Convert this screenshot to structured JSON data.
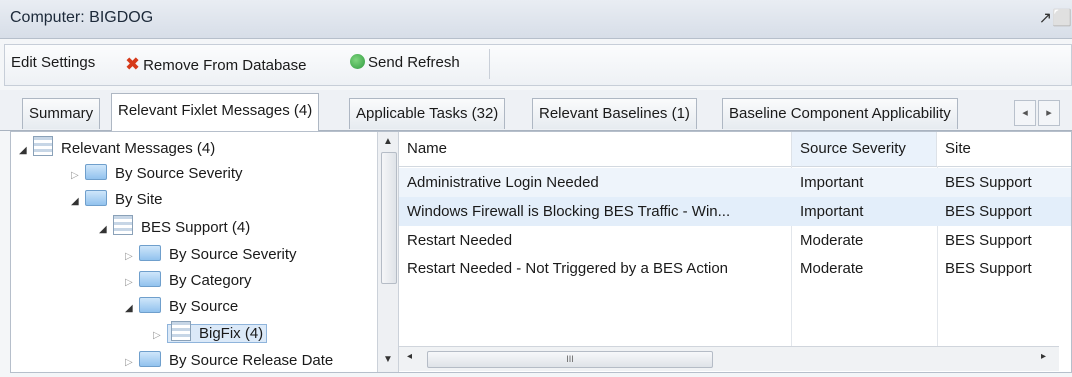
{
  "window": {
    "title": "Computer: BIGDOG"
  },
  "toolbar": {
    "edit_settings": "Edit Settings",
    "remove_from_database": "Remove From Database",
    "send_refresh": "Send Refresh"
  },
  "tabs": [
    {
      "label": "Summary"
    },
    {
      "label": "Relevant Fixlet Messages (4)"
    },
    {
      "label": "Applicable Tasks (32)"
    },
    {
      "label": "Relevant Baselines (1)"
    },
    {
      "label": "Baseline Component Applicability"
    }
  ],
  "tree": {
    "items": [
      {
        "label": "Relevant Messages (4)"
      },
      {
        "label": "By Source Severity"
      },
      {
        "label": "By Site"
      },
      {
        "label": "BES Support (4)"
      },
      {
        "label": "By Source Severity"
      },
      {
        "label": "By Category"
      },
      {
        "label": "By Source"
      },
      {
        "label": "BigFix (4)"
      },
      {
        "label": "By Source Release Date"
      }
    ]
  },
  "list": {
    "columns": [
      "Name",
      "Source Severity",
      "Site"
    ],
    "rows": [
      {
        "name": "Administrative Login Needed",
        "severity": "Important",
        "site": "BES Support"
      },
      {
        "name": "Windows Firewall is Blocking BES Traffic - Win...",
        "severity": "Important",
        "site": "BES Support"
      },
      {
        "name": "Restart Needed",
        "severity": "Moderate",
        "site": "BES Support"
      },
      {
        "name": "Restart Needed - Not Triggered by a BES Action",
        "severity": "Moderate",
        "site": "BES Support"
      }
    ]
  },
  "colors": {
    "selection": "#e3eefa",
    "remove_icon": "#d63a1a"
  }
}
